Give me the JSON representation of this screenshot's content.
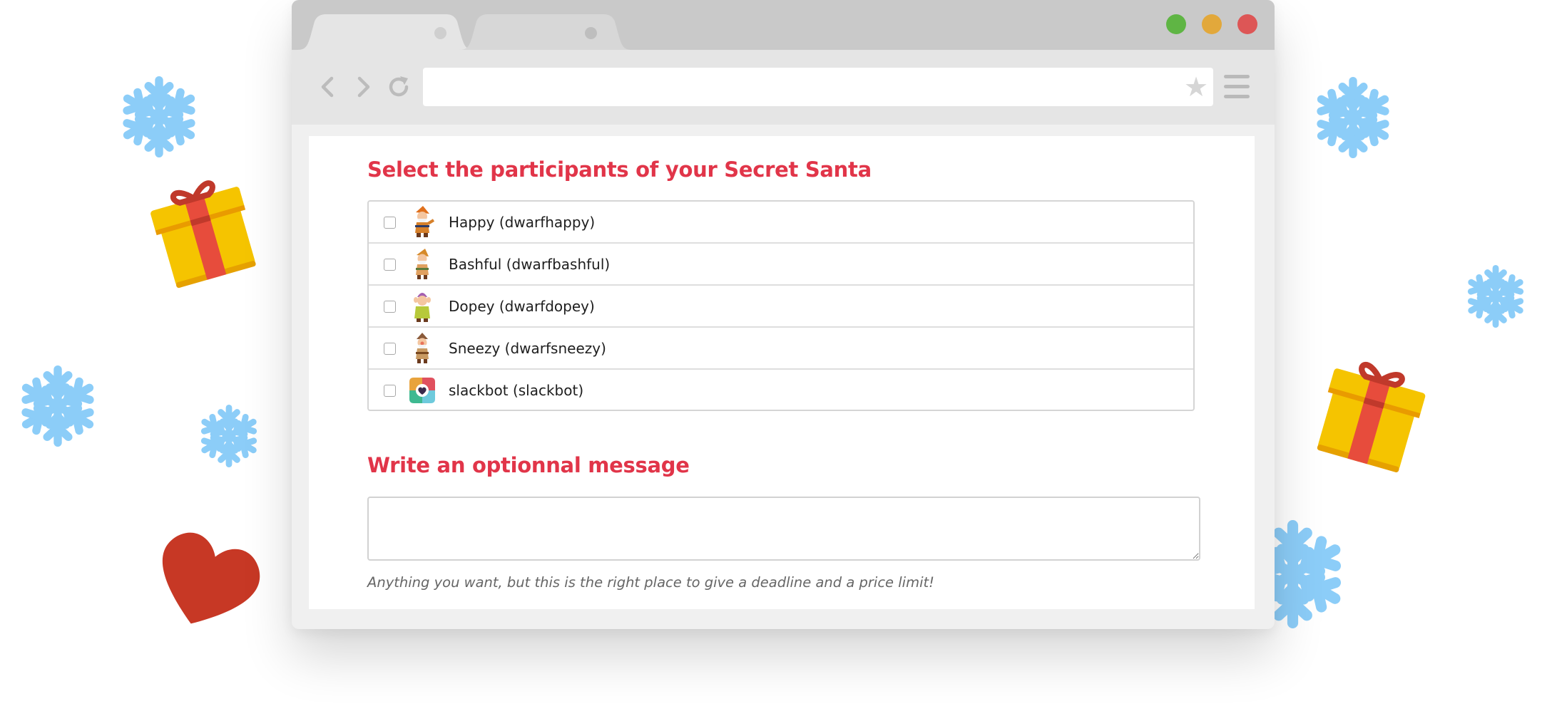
{
  "colors": {
    "accent": "#e13549",
    "snowflake": "#8ccdf8",
    "gift_box": "#f5c400",
    "gift_ribbon": "#e74c3c",
    "heart": "#c73825",
    "traffic_green": "#5fb544",
    "traffic_yellow": "#e2a83b",
    "traffic_red": "#dd5656"
  },
  "browser": {
    "tabs": [
      {
        "label": "",
        "active": true
      },
      {
        "label": "",
        "active": false
      }
    ],
    "address_bar": {
      "value": ""
    },
    "bookmark_icon": "star-icon",
    "menu_icon": "hamburger-menu-icon"
  },
  "participants_section": {
    "title": "Select the participants of your Secret Santa",
    "participants": [
      {
        "label": "Happy (dwarfhappy)",
        "checked": false,
        "avatar": "happy-dwarf-avatar"
      },
      {
        "label": "Bashful (dwarfbashful)",
        "checked": false,
        "avatar": "bashful-dwarf-avatar"
      },
      {
        "label": "Dopey (dwarfdopey)",
        "checked": false,
        "avatar": "dopey-dwarf-avatar"
      },
      {
        "label": "Sneezy (dwarfsneezy)",
        "checked": false,
        "avatar": "sneezy-dwarf-avatar"
      },
      {
        "label": "slackbot (slackbot)",
        "checked": false,
        "avatar": "slackbot-avatar"
      }
    ]
  },
  "message_section": {
    "title": "Write an optionnal message",
    "value": "",
    "hint": "Anything you want, but this is the right place to give a deadline and a price limit!"
  }
}
